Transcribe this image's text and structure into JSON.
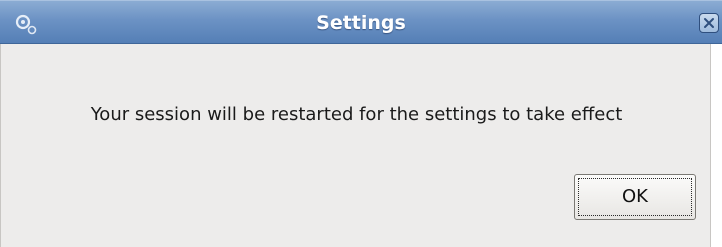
{
  "window": {
    "title": "Settings",
    "app_icon": "gears-icon",
    "close_icon": "close-icon"
  },
  "dialog": {
    "message": "Your session will be restarted for the settings to take effect",
    "ok_label": "OK"
  },
  "colors": {
    "titlebar": "#6c92c4",
    "title_text": "#ffffff",
    "dialog_background": "#edeceb"
  }
}
